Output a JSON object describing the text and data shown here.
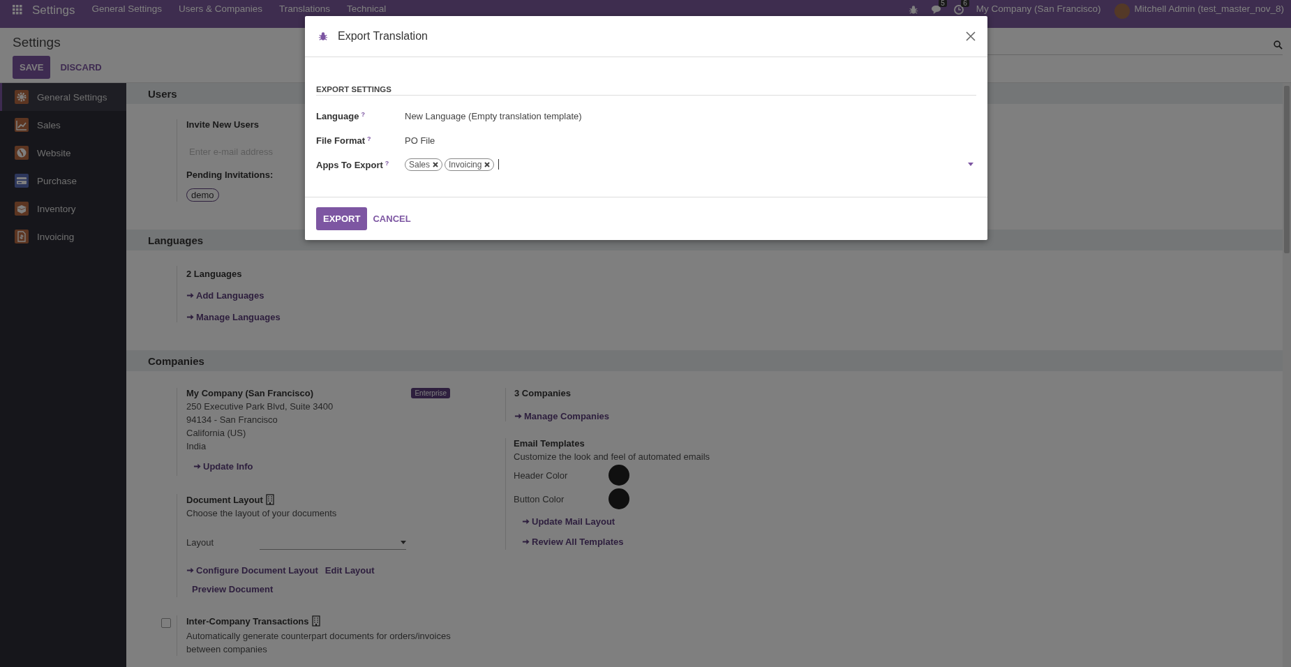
{
  "topbar": {
    "app_title": "Settings",
    "menu": [
      "General Settings",
      "Users & Companies",
      "Translations",
      "Technical"
    ],
    "chat_count": "5",
    "activity_count": "6",
    "company": "My Company (San Francisco)",
    "user": "Mitchell Admin (test_master_nov_8)"
  },
  "control_panel": {
    "title": "Settings",
    "buttons": [
      "SAVE",
      "DISCARD"
    ]
  },
  "sidebar": {
    "items": [
      {
        "label": "General Settings",
        "kind": "gear",
        "selected": true
      },
      {
        "label": "Sales",
        "kind": "chart",
        "selected": false
      },
      {
        "label": "Website",
        "kind": "globe",
        "selected": false
      },
      {
        "label": "Purchase",
        "kind": "card",
        "selected": false
      },
      {
        "label": "Inventory",
        "kind": "box",
        "selected": false
      },
      {
        "label": "Invoicing",
        "kind": "invoice",
        "selected": false
      }
    ]
  },
  "users": {
    "title": "Users",
    "invite_label": "Invite New Users",
    "email_placeholder": "Enter e-mail address",
    "pending_label": "Pending Invitations:",
    "pending": [
      "demo"
    ]
  },
  "languages": {
    "title": "Languages",
    "count": "2 Languages",
    "links": [
      "Add Languages",
      "Manage Languages"
    ]
  },
  "companies": {
    "title": "Companies",
    "company_name": "My Company (San Francisco)",
    "badge": "Enterprise",
    "address": [
      "250 Executive Park Blvd, Suite 3400",
      "94134 - San Francisco",
      "California (US)",
      "India"
    ],
    "update_link": "Update Info",
    "document_layout": {
      "title": "Document Layout",
      "description": "Choose the layout of your documents",
      "layout_label": "Layout",
      "links": [
        {
          "label": "Configure Document Layout",
          "kind": "arrow"
        },
        {
          "label": "Edit Layout",
          "kind": "plain"
        },
        {
          "label": "Preview Document",
          "kind": "plain"
        }
      ]
    },
    "inter_company": {
      "title": "Inter-Company Transactions",
      "description": "Automatically generate counterpart documents for orders/invoices between companies",
      "checked": false
    },
    "count": "3 Companies",
    "manage_link": "Manage Companies",
    "email_templates": {
      "title": "Email Templates",
      "description": "Customize the look and feel of automated emails",
      "colors": [
        {
          "label": "Header Color",
          "color": "#202020"
        },
        {
          "label": "Button Color",
          "color": "#202020"
        }
      ],
      "links": [
        "Update Mail Layout",
        "Review All Templates"
      ]
    }
  },
  "dialog": {
    "title": "Export Translation",
    "section": "EXPORT SETTINGS",
    "fields": [
      {
        "label": "Language",
        "help": "?",
        "kind": "text",
        "value": "New Language (Empty translation template)"
      },
      {
        "label": "File Format",
        "help": "?",
        "kind": "text",
        "value": "PO File"
      },
      {
        "label": "Apps To Export",
        "help": "?",
        "kind": "tags",
        "tags": [
          "Sales",
          "Invoicing"
        ]
      }
    ],
    "buttons": [
      "EXPORT",
      "CANCEL"
    ]
  }
}
